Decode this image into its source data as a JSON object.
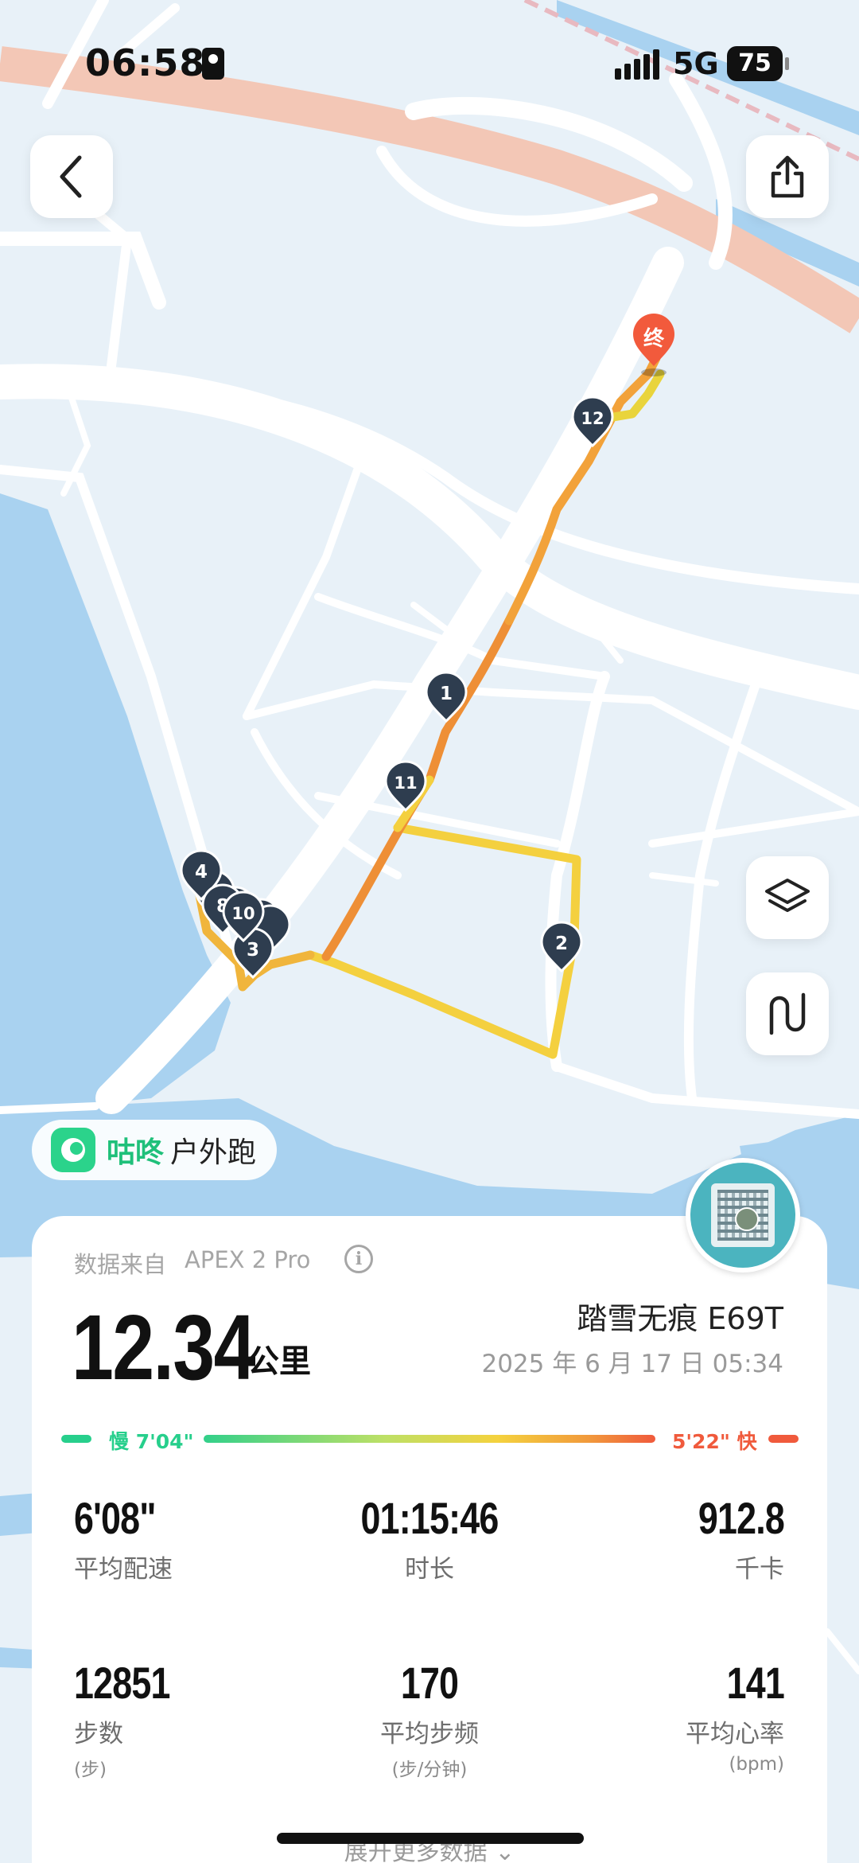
{
  "status_bar": {
    "time": "06:58",
    "network": "5G",
    "battery": "75"
  },
  "map": {
    "end_marker_label": "终",
    "split_markers": [
      "1",
      "2",
      "3",
      "4",
      "8",
      "10",
      "11",
      "12"
    ],
    "route_colors": {
      "slow": "#f4d03f",
      "medium": "#f2a43a",
      "fast": "#ee8a35"
    }
  },
  "brand": {
    "name": "咕咚",
    "activity_type": "户外跑"
  },
  "summary": {
    "source_label": "数据来自",
    "source_device": "APEX 2 Pro",
    "distance": "12.34",
    "distance_unit": "公里",
    "shoe": "踏雪无痕 E69T",
    "datetime": "2025 年 6 月 17 日  05:34"
  },
  "pace_scale": {
    "slow_label": "慢 7'04\"",
    "fast_label": "5'22\" 快",
    "slow_color": "#27cf8c",
    "fast_color": "#f05a3c"
  },
  "stats": [
    {
      "value": "6'08\"",
      "label": "平均配速",
      "unit": ""
    },
    {
      "value": "01:15:46",
      "label": "时长",
      "unit": ""
    },
    {
      "value": "912.8",
      "label": "千卡",
      "unit": ""
    },
    {
      "value": "12851",
      "label": "步数",
      "unit": "(步)"
    },
    {
      "value": "170",
      "label": "平均步频",
      "unit": "(步/分钟)"
    },
    {
      "value": "141",
      "label": "平均心率",
      "unit": "(bpm)"
    }
  ],
  "expand_label": "展开更多数据"
}
